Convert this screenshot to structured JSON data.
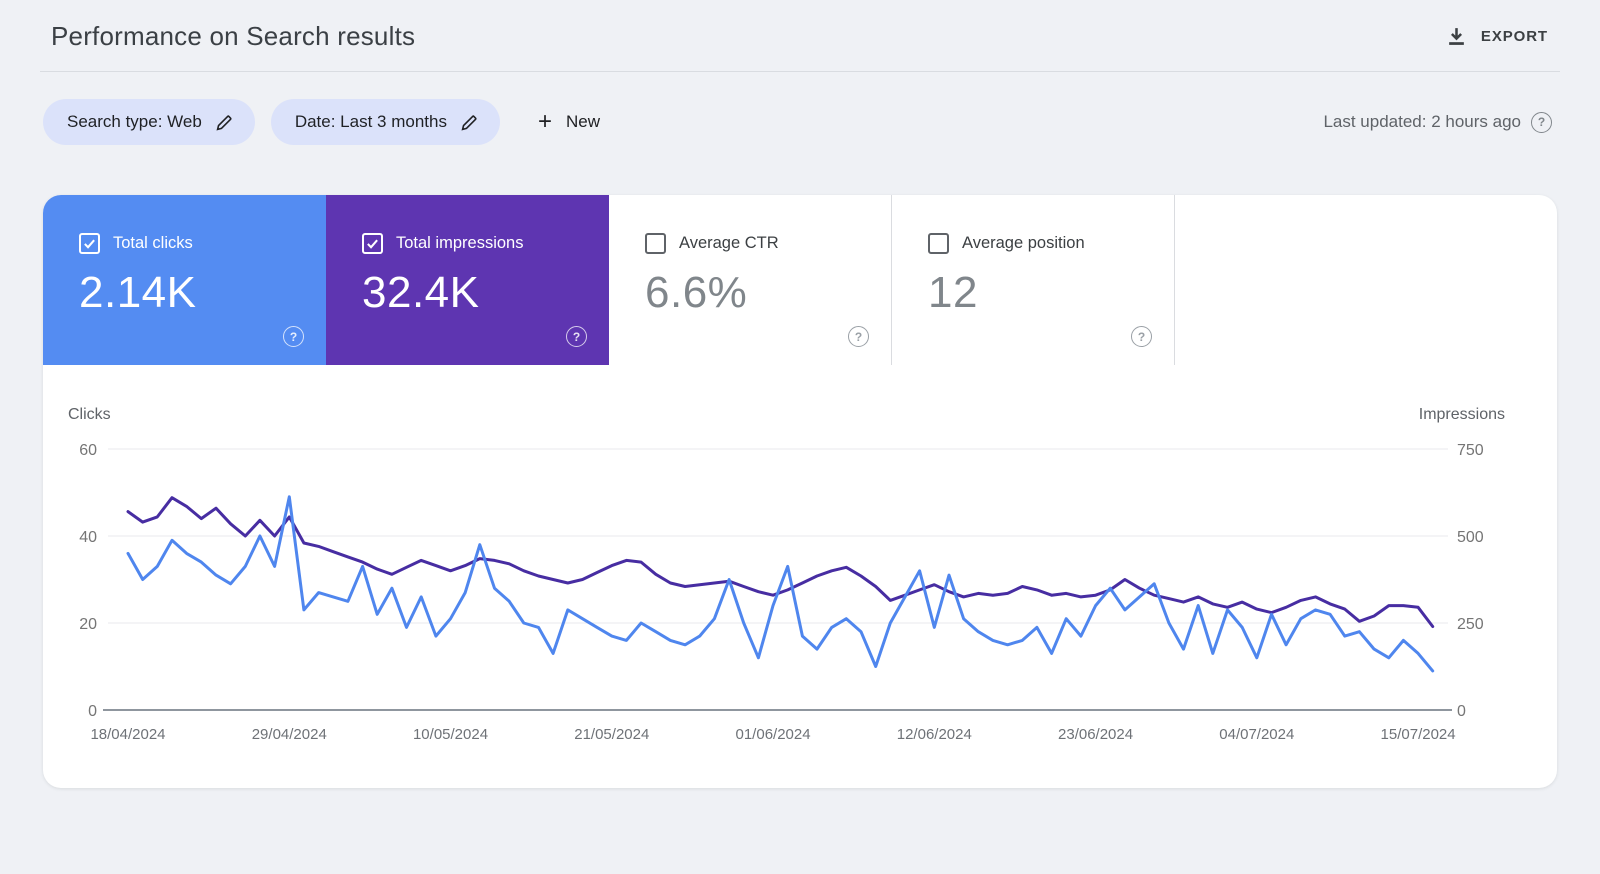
{
  "header": {
    "title": "Performance on Search results",
    "export_label": "EXPORT"
  },
  "filters": {
    "search_type_chip": "Search type: Web",
    "date_chip": "Date: Last 3 months",
    "new_button": "New",
    "last_updated": "Last updated: 2 hours ago",
    "help_glyph": "?"
  },
  "metric_cards": [
    {
      "label": "Total clicks",
      "value": "2.14K",
      "checked": true,
      "bg": "#548cf2",
      "help_glyph": "?"
    },
    {
      "label": "Total impressions",
      "value": "32.4K",
      "checked": true,
      "bg": "#5e35b1",
      "help_glyph": "?"
    },
    {
      "label": "Average CTR",
      "value": "6.6%",
      "checked": false,
      "bg": "",
      "help_glyph": "?"
    },
    {
      "label": "Average position",
      "value": "12",
      "checked": false,
      "bg": "",
      "help_glyph": "?"
    }
  ],
  "chart_data": {
    "type": "line",
    "start_date": "18/04/2024",
    "end_date": "15/07/2024",
    "x_labels_shown": [
      "18/04/2024",
      "29/04/2024",
      "10/05/2024",
      "21/05/2024",
      "01/06/2024",
      "12/06/2024",
      "23/06/2024",
      "04/07/2024",
      "15/07/2024"
    ],
    "x_label_every_n_points": 11,
    "grid": "horizontal",
    "y_left": {
      "label": "Clicks",
      "ticks": [
        0,
        20,
        40,
        60
      ],
      "max": 60
    },
    "y_right": {
      "label": "Impressions",
      "ticks": [
        0,
        250,
        500,
        750
      ],
      "max": 750
    },
    "series": [
      {
        "name": "Impressions",
        "axis": "right",
        "color": "#472da2",
        "values": [
          570,
          540,
          555,
          610,
          585,
          550,
          580,
          535,
          500,
          545,
          500,
          555,
          480,
          470,
          455,
          440,
          425,
          405,
          390,
          410,
          430,
          415,
          400,
          415,
          435,
          430,
          420,
          400,
          385,
          375,
          365,
          375,
          395,
          415,
          430,
          425,
          390,
          365,
          355,
          360,
          365,
          370,
          355,
          340,
          330,
          345,
          365,
          385,
          400,
          410,
          385,
          355,
          315,
          330,
          345,
          360,
          340,
          325,
          335,
          330,
          335,
          355,
          345,
          330,
          335,
          325,
          330,
          345,
          375,
          350,
          330,
          320,
          310,
          325,
          305,
          295,
          310,
          290,
          280,
          295,
          315,
          325,
          305,
          290,
          255,
          270,
          300,
          300,
          295,
          240
        ]
      },
      {
        "name": "Clicks",
        "axis": "left",
        "color": "#4f86ee",
        "values": [
          36,
          30,
          33,
          39,
          36,
          34,
          31,
          29,
          33,
          40,
          33,
          49,
          23,
          27,
          26,
          25,
          33,
          22,
          28,
          19,
          26,
          17,
          21,
          27,
          38,
          28,
          25,
          20,
          19,
          13,
          23,
          21,
          19,
          17,
          16,
          20,
          18,
          16,
          15,
          17,
          21,
          30,
          20,
          12,
          24,
          33,
          17,
          14,
          19,
          21,
          18,
          10,
          20,
          26,
          32,
          19,
          31,
          21,
          18,
          16,
          15,
          16,
          19,
          13,
          21,
          17,
          24,
          28,
          23,
          26,
          29,
          20,
          14,
          24,
          13,
          23,
          19,
          12,
          22,
          15,
          21,
          23,
          22,
          17,
          18,
          14,
          12,
          16,
          13,
          9
        ]
      }
    ],
    "colors": {
      "grid": "#e8eaed",
      "axis_line": "#8f969e",
      "tick_text": "#757575",
      "axis_header_text": "#5f6368",
      "date_text": "#6e7277"
    }
  }
}
